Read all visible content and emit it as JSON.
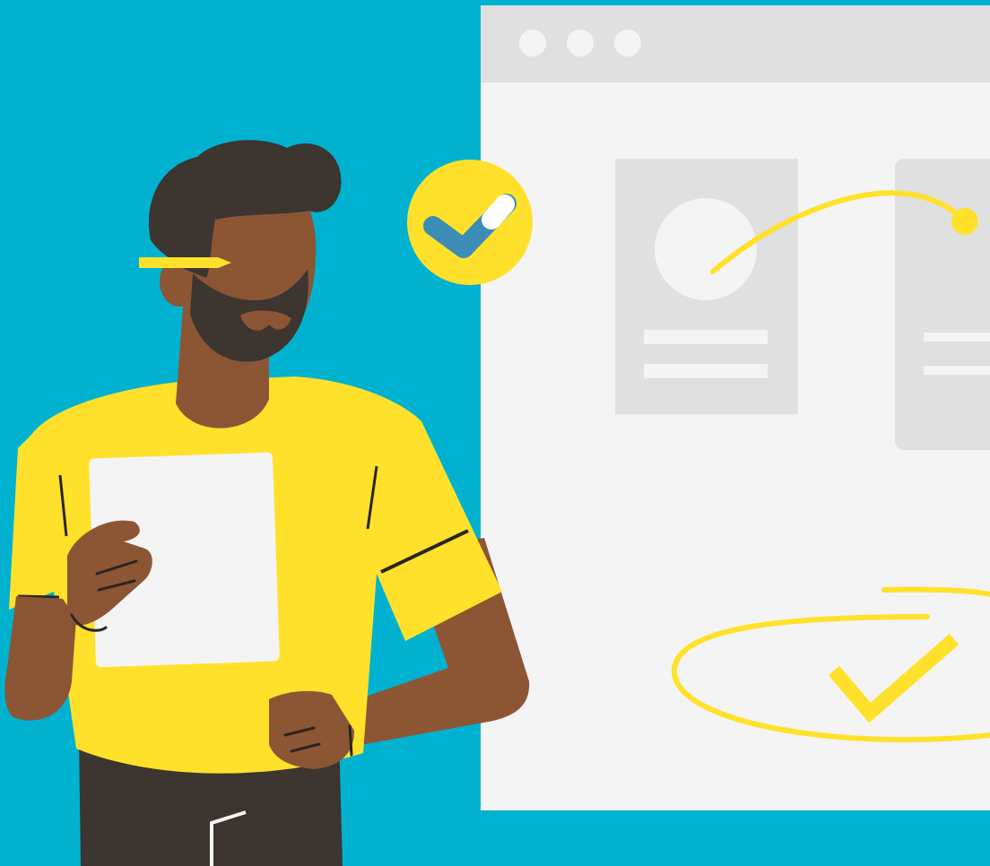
{
  "illustration": {
    "background_color": "#00b2d0",
    "accent_color": "#ffe12b",
    "skin_color": "#8c5634",
    "hair_color": "#3c3530",
    "window_color": "#f4f4f4",
    "titlebar_color": "#e0e0e0",
    "placeholder_color": "#e0e0e0",
    "paper_color": "#f4f4f4",
    "pants_color": "#3c3530",
    "line_color": "#2a2523"
  },
  "window": {
    "titlebar_dots": 3
  },
  "icons": [
    "check-badge-icon",
    "checkmark-icon",
    "ellipse-highlight-icon",
    "connector-curve-icon",
    "pencil-icon"
  ]
}
